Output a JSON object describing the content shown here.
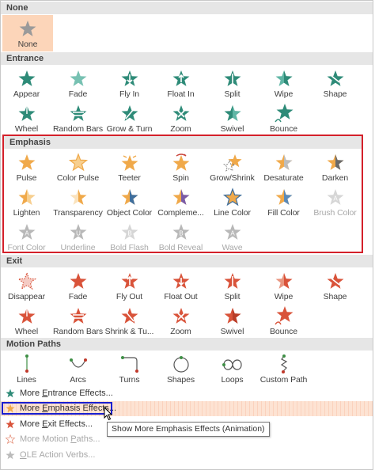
{
  "colors": {
    "teal": "#2e8b78",
    "teal_light": "#5fb6a5",
    "gold": "#f0a94a",
    "gold_light": "#f7cf8f",
    "red": "#d9533a",
    "red_dark": "#b93d28",
    "gray": "#b8b8b8",
    "purple": "#7a5ca8",
    "highlight_border": "#d4202a",
    "focus_border": "#1a1fd0"
  },
  "sections": {
    "none": "None",
    "entrance": "Entrance",
    "emphasis": "Emphasis",
    "exit": "Exit",
    "motion": "Motion Paths"
  },
  "none_item": {
    "label": "None",
    "icon": "star-gray-icon"
  },
  "entrance": [
    {
      "label": "Appear",
      "icon": "appear-icon"
    },
    {
      "label": "Fade",
      "icon": "fade-icon"
    },
    {
      "label": "Fly In",
      "icon": "fly-in-icon"
    },
    {
      "label": "Float In",
      "icon": "float-in-icon"
    },
    {
      "label": "Split",
      "icon": "split-icon"
    },
    {
      "label": "Wipe",
      "icon": "wipe-icon"
    },
    {
      "label": "Shape",
      "icon": "shape-icon"
    },
    {
      "label": "Wheel",
      "icon": "wheel-icon"
    },
    {
      "label": "Random Bars",
      "icon": "random-bars-icon"
    },
    {
      "label": "Grow & Turn",
      "icon": "grow-turn-icon"
    },
    {
      "label": "Zoom",
      "icon": "zoom-icon"
    },
    {
      "label": "Swivel",
      "icon": "swivel-icon"
    },
    {
      "label": "Bounce",
      "icon": "bounce-icon"
    }
  ],
  "emphasis": [
    {
      "label": "Pulse",
      "icon": "pulse-icon",
      "disabled": false
    },
    {
      "label": "Color Pulse",
      "icon": "color-pulse-icon",
      "disabled": false
    },
    {
      "label": "Teeter",
      "icon": "teeter-icon",
      "disabled": false
    },
    {
      "label": "Spin",
      "icon": "spin-icon",
      "disabled": false
    },
    {
      "label": "Grow/Shrink",
      "icon": "grow-shrink-icon",
      "disabled": false
    },
    {
      "label": "Desaturate",
      "icon": "desaturate-icon",
      "disabled": false
    },
    {
      "label": "Darken",
      "icon": "darken-icon",
      "disabled": false
    },
    {
      "label": "Lighten",
      "icon": "lighten-icon",
      "disabled": false
    },
    {
      "label": "Transparency",
      "icon": "transparency-icon",
      "disabled": false
    },
    {
      "label": "Object Color",
      "icon": "object-color-icon",
      "disabled": false
    },
    {
      "label": "Compleme...",
      "icon": "complementary-color-icon",
      "disabled": false
    },
    {
      "label": "Line Color",
      "icon": "line-color-icon",
      "disabled": false
    },
    {
      "label": "Fill Color",
      "icon": "fill-color-icon",
      "disabled": false
    },
    {
      "label": "Brush Color",
      "icon": "brush-color-icon",
      "disabled": true
    },
    {
      "label": "Font Color",
      "icon": "font-color-icon",
      "disabled": true
    },
    {
      "label": "Underline",
      "icon": "underline-icon",
      "disabled": true
    },
    {
      "label": "Bold Flash",
      "icon": "bold-flash-icon",
      "disabled": true
    },
    {
      "label": "Bold Reveal",
      "icon": "bold-reveal-icon",
      "disabled": true
    },
    {
      "label": "Wave",
      "icon": "wave-icon",
      "disabled": true
    }
  ],
  "exit": [
    {
      "label": "Disappear",
      "icon": "disappear-icon"
    },
    {
      "label": "Fade",
      "icon": "fade-out-icon"
    },
    {
      "label": "Fly Out",
      "icon": "fly-out-icon"
    },
    {
      "label": "Float Out",
      "icon": "float-out-icon"
    },
    {
      "label": "Split",
      "icon": "split-out-icon"
    },
    {
      "label": "Wipe",
      "icon": "wipe-out-icon"
    },
    {
      "label": "Shape",
      "icon": "shape-out-icon"
    },
    {
      "label": "Wheel",
      "icon": "wheel-out-icon"
    },
    {
      "label": "Random Bars",
      "icon": "random-bars-out-icon"
    },
    {
      "label": "Shrink & Tu...",
      "icon": "shrink-turn-icon"
    },
    {
      "label": "Zoom",
      "icon": "zoom-out-icon"
    },
    {
      "label": "Swivel",
      "icon": "swivel-out-icon"
    },
    {
      "label": "Bounce",
      "icon": "bounce-out-icon"
    }
  ],
  "motion": [
    {
      "label": "Lines",
      "icon": "lines-path-icon"
    },
    {
      "label": "Arcs",
      "icon": "arcs-path-icon"
    },
    {
      "label": "Turns",
      "icon": "turns-path-icon"
    },
    {
      "label": "Shapes",
      "icon": "shapes-path-icon"
    },
    {
      "label": "Loops",
      "icon": "loops-path-icon"
    },
    {
      "label": "Custom Path",
      "icon": "custom-path-icon"
    }
  ],
  "more": [
    {
      "pre": "More ",
      "key": "E",
      "post": "ntrance Effects...",
      "icon": "entrance-star-icon",
      "disabled": false
    },
    {
      "pre": "More ",
      "key": "E",
      "post": "mphasis Effects...",
      "icon": "emphasis-star-icon",
      "disabled": false
    },
    {
      "pre": "More ",
      "key": "E",
      "post": "xit Effects...",
      "icon": "exit-star-icon",
      "disabled": false
    },
    {
      "pre": "More Motion ",
      "key": "P",
      "post": "aths...",
      "icon": "motion-star-icon",
      "disabled": true
    },
    {
      "pre": "",
      "key": "O",
      "post": "LE Action Verbs...",
      "icon": "ole-star-icon",
      "disabled": true
    }
  ],
  "tooltip": "Show More Emphasis Effects (Animation)"
}
